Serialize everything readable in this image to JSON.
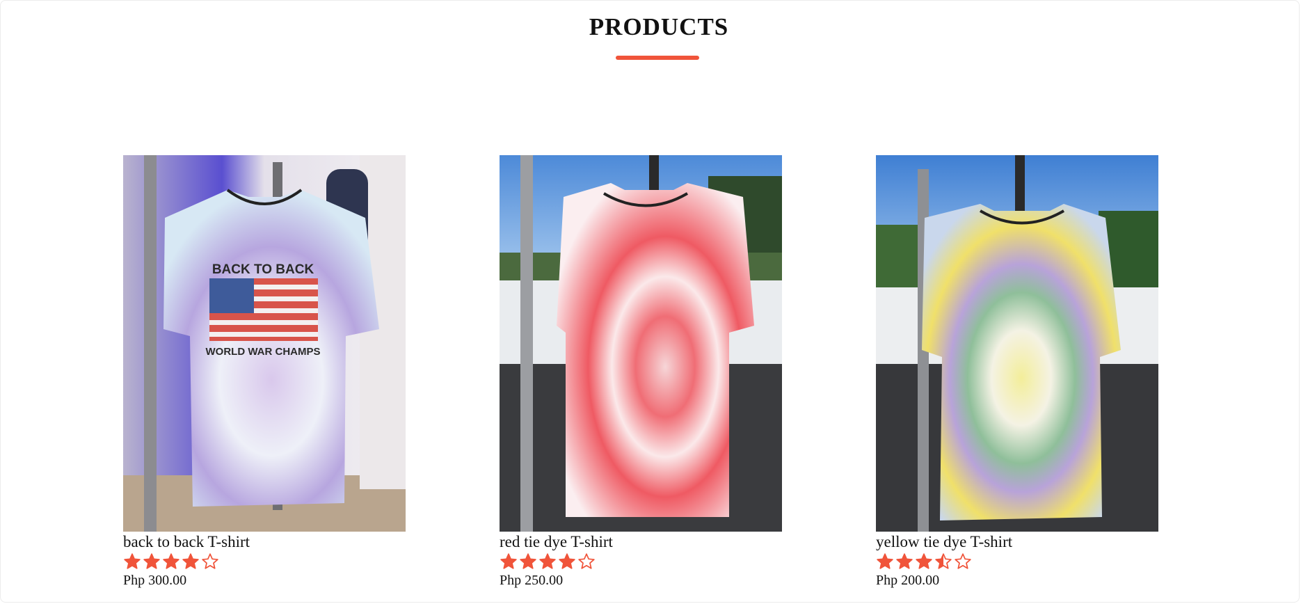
{
  "section": {
    "title": "PRODUCTS",
    "accent_color": "#f0543a"
  },
  "products": [
    {
      "name": "back to back T-shirt",
      "rating": 4,
      "max_rating": 5,
      "price": "Php 300.00",
      "image": {
        "print_top": "BACK TO BACK",
        "print_bottom": "WORLD WAR CHAMPS"
      }
    },
    {
      "name": "red tie dye T-shirt",
      "rating": 4,
      "max_rating": 5,
      "price": "Php 250.00"
    },
    {
      "name": "yellow tie dye T-shirt",
      "rating": 3.5,
      "max_rating": 5,
      "price": "Php 200.00"
    }
  ]
}
